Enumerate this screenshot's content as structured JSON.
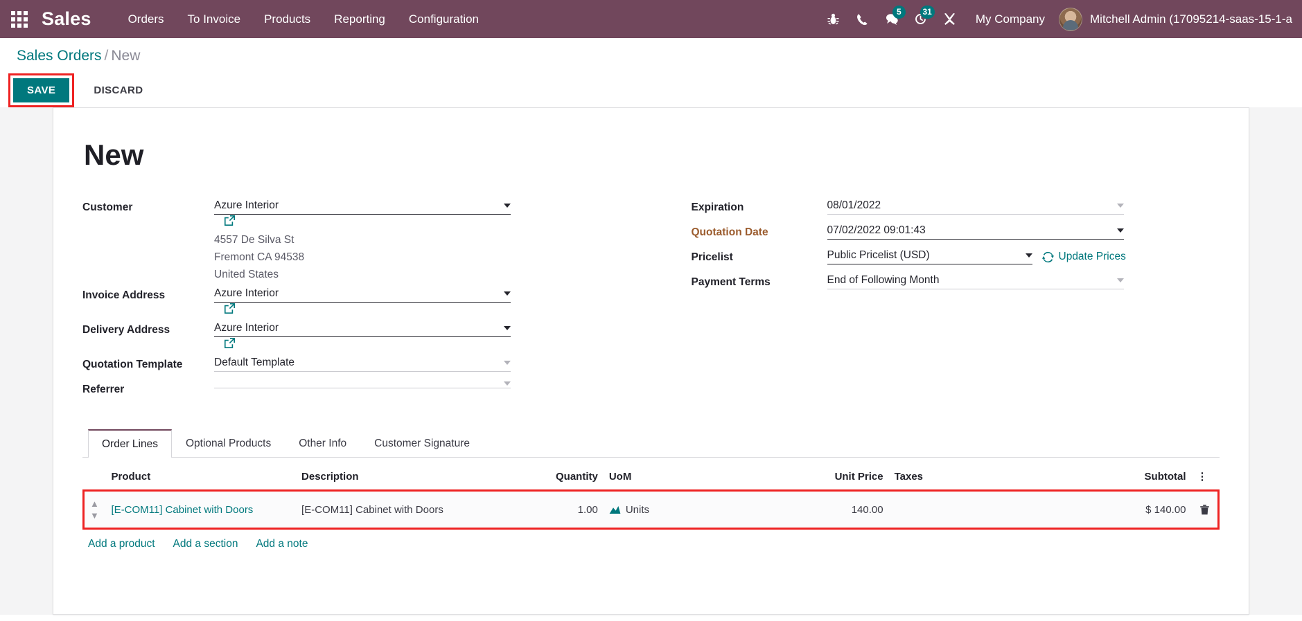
{
  "navbar": {
    "apps_icon": "apps-grid-icon",
    "brand": "Sales",
    "menu": [
      {
        "label": "Orders"
      },
      {
        "label": "To Invoice"
      },
      {
        "label": "Products"
      },
      {
        "label": "Reporting"
      },
      {
        "label": "Configuration"
      }
    ],
    "sys_icons": [
      {
        "name": "bug-icon",
        "badge": null
      },
      {
        "name": "phone-icon",
        "badge": null
      },
      {
        "name": "chat-icon",
        "badge": "5"
      },
      {
        "name": "activity-clock-icon",
        "badge": "31"
      },
      {
        "name": "tools-icon",
        "badge": null
      }
    ],
    "company": "My Company",
    "user": "Mitchell Admin (17095214-saas-15-1-a",
    "bg_color": "#71475c",
    "badge_color": "#00787d"
  },
  "breadcrumb": {
    "root": "Sales Orders",
    "separator": "/",
    "current": "New"
  },
  "buttons": {
    "save": "SAVE",
    "discard": "DISCARD",
    "save_bg": "#00787d",
    "highlight_color": "#ee2222"
  },
  "record": {
    "title": "New"
  },
  "form": {
    "left": [
      {
        "label": "Customer",
        "value": "Azure Interior",
        "has_caret": true,
        "has_external": true,
        "address": [
          "4557 De Silva St",
          "Fremont CA 94538",
          "United States"
        ]
      },
      {
        "label": "Invoice Address",
        "value": "Azure Interior",
        "has_caret": true,
        "has_external": true
      },
      {
        "label": "Delivery Address",
        "value": "Azure Interior",
        "has_caret": true,
        "has_external": true
      },
      {
        "label": "Quotation Template",
        "value": "Default Template",
        "has_caret": true,
        "has_external": false
      },
      {
        "label": "Referrer",
        "value": "",
        "has_caret": true,
        "has_external": false
      }
    ],
    "right": [
      {
        "label": "Expiration",
        "value": "08/01/2022",
        "required": false,
        "has_caret": true
      },
      {
        "label": "Quotation Date",
        "value": "07/02/2022 09:01:43",
        "required": true,
        "has_caret": true
      },
      {
        "label": "Pricelist",
        "value": "Public Pricelist (USD)",
        "required": false,
        "has_caret": true,
        "action": "Update Prices",
        "action_icon": "refresh-icon"
      },
      {
        "label": "Payment Terms",
        "value": "End of Following Month",
        "required": false,
        "has_caret": true
      }
    ]
  },
  "notebook": {
    "tabs": [
      {
        "label": "Order Lines",
        "active": true
      },
      {
        "label": "Optional Products",
        "active": false
      },
      {
        "label": "Other Info",
        "active": false
      },
      {
        "label": "Customer Signature",
        "active": false
      }
    ]
  },
  "order_lines": {
    "columns": [
      "Product",
      "Description",
      "Quantity",
      "UoM",
      "Unit Price",
      "Taxes",
      "Subtotal"
    ],
    "options_icon": "kebab-menu-icon",
    "rows": [
      {
        "drag": "drag-handle-icon",
        "product": "[E-COM11] Cabinet with Doors",
        "description": "[E-COM11] Cabinet with Doors",
        "quantity": "1.00",
        "uom_icon": "forecast-chart-icon",
        "uom": "Units",
        "unit_price": "140.00",
        "taxes": "",
        "subtotal": "$ 140.00",
        "delete_icon": "trash-icon"
      }
    ],
    "add_links": [
      {
        "label": "Add a product"
      },
      {
        "label": "Add a section"
      },
      {
        "label": "Add a note"
      }
    ]
  }
}
